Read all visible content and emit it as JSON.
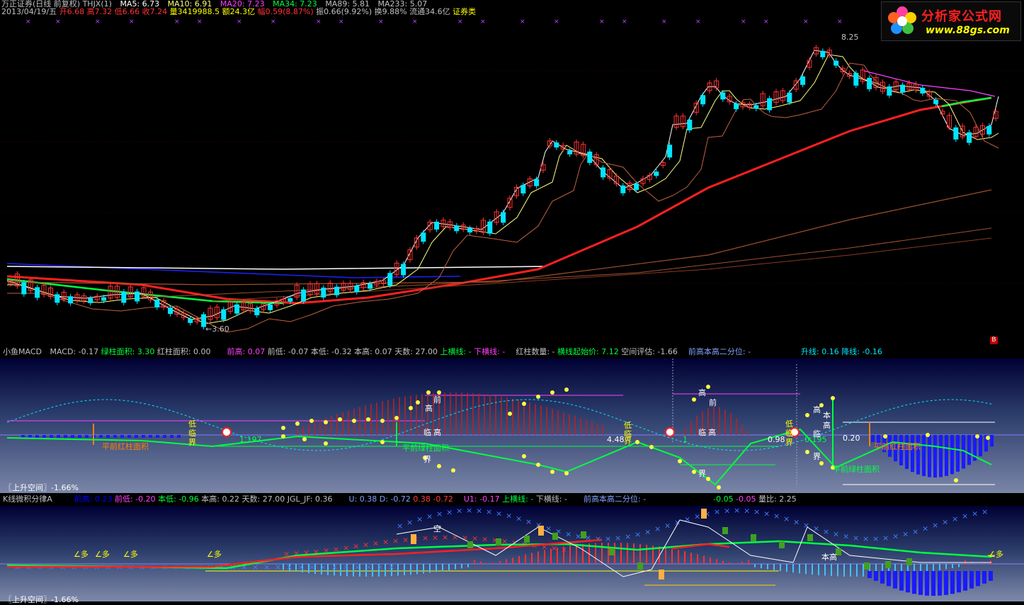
{
  "colors": {
    "up_candle": "#ff3333",
    "down_candle": "#00e5ff",
    "ma_white": "#ffffff",
    "ma_yellow": "#ffff80",
    "ma_magenta": "#ff40ff",
    "ma_green": "#00ff40",
    "ma_red": "#ff2020",
    "ma_brown": "#a0522d",
    "accent_yellow": "#ffff00",
    "accent_blue": "#0000ff"
  },
  "main": {
    "title_line1": {
      "broker": "万正证券(日线 前复权) THJX(1)",
      "ma5": "MA5: 6.73",
      "ma10": "MA10: 6.91",
      "ma20": "MA20: 7.23",
      "ma34": "MA34: 7.23",
      "ma89": "MA89: 5.81",
      "ma233": "MA233: 5.07"
    },
    "title_line2": {
      "date": "2013/04/19/五",
      "open": "开6.68",
      "high": "高7.32",
      "low": "低6.66",
      "close": "收7.24",
      "volume": "量3419988.5",
      "amount": "额24.3亿",
      "change": "幅0.59(8.87%)",
      "amplitude": "振0.66(9.92%)",
      "turnover": "换9.88%",
      "float": "流通34.6亿",
      "sector": "证券类"
    },
    "high_marker": "8.25",
    "low_marker": "←3.60",
    "badge": "B"
  },
  "logo": {
    "name": "分析家公式网",
    "url": "www.88gs.com"
  },
  "macd": {
    "header": {
      "name": "小鱼MACD",
      "macd": "MACD: -0.17",
      "green_area": "绿柱面积: 3.30",
      "red_area": "红柱面积: 0.00",
      "prev_high": "前高: 0.07",
      "prev_low": "前低: -0.07",
      "cur_low": "本低: -0.32",
      "cur_high": "本高: 0.07",
      "days": "天数: 27.00",
      "up_line": "上横线: -",
      "down_line": "下横线: -",
      "red_count": "红柱数量: -",
      "line_start": "横线起始价: 7.12",
      "space_eval": "空间评估: -1.66",
      "quantile": "前高本高二分位: -",
      "rise_line": "升线: 0.16",
      "fall_line": "降线: -0.16"
    },
    "footer": "〖上升空间〗-1.66%",
    "labels": {
      "low": "低",
      "near": "临",
      "bound": "界",
      "high": "高",
      "prev": "前",
      "cur": "本",
      "prev_red_area": "平前红柱面积",
      "prev_green_area": "平前绿柱面积",
      "v1": "1.197",
      "v2": "4.48",
      "v3": "1",
      "v4": "0.98",
      "v5": "0.195",
      "v6": "0.20"
    }
  },
  "kline": {
    "header": {
      "name": "K线微积分律A",
      "prev_high": "前高: 0.23",
      "prev_low": "前低: -0.20",
      "cur_low": "本低: -0.96",
      "cur_high": "本高: 0.22",
      "days": "天数: 27.00",
      "jgl": "JGL_JF: 0.36",
      "u": "U: 0.38",
      "d": "D: -0.72",
      "v1": "0.38",
      "v2": "-0.72",
      "u1": "U1: -0.17",
      "up_line": "上横线: -",
      "down_line": "下横线: -",
      "quantile": "前高本高二分位: -",
      "v3": "-0.05",
      "v4": "-0.05",
      "vol_ratio": "量比: 2.25"
    },
    "footer": "〖上升空间〗-1.66%",
    "labels": {
      "duo": "∠多",
      "kong": "空",
      "cur_high": "本高"
    }
  }
}
